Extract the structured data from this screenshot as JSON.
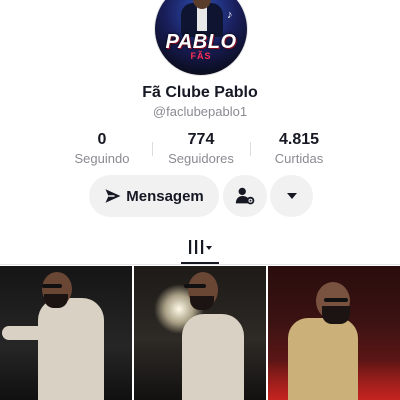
{
  "profile": {
    "avatar_logo": "PABLO",
    "avatar_sub": "FÃS",
    "name": "Fã Clube Pablo",
    "handle": "@faclubepablo1"
  },
  "stats": [
    {
      "value": "0",
      "label": "Seguindo"
    },
    {
      "value": "774",
      "label": "Seguidores"
    },
    {
      "value": "4.815",
      "label": "Curtidas"
    }
  ],
  "actions": {
    "message_label": "Mensagem",
    "follow_icon": "person-settings-icon",
    "more_icon": "caret-down-icon"
  },
  "tabs": {
    "videos_icon": "grid-bars-icon"
  },
  "videos": [
    {
      "thumbnail": "man-in-white-jacket-singing"
    },
    {
      "thumbnail": "man-in-white-jacket-stage-light"
    },
    {
      "thumbnail": "man-in-tan-shirt-red-stage"
    }
  ],
  "colors": {
    "text_primary": "#161823",
    "text_secondary": "#8a8b91",
    "button_bg": "#f1f1f2"
  }
}
